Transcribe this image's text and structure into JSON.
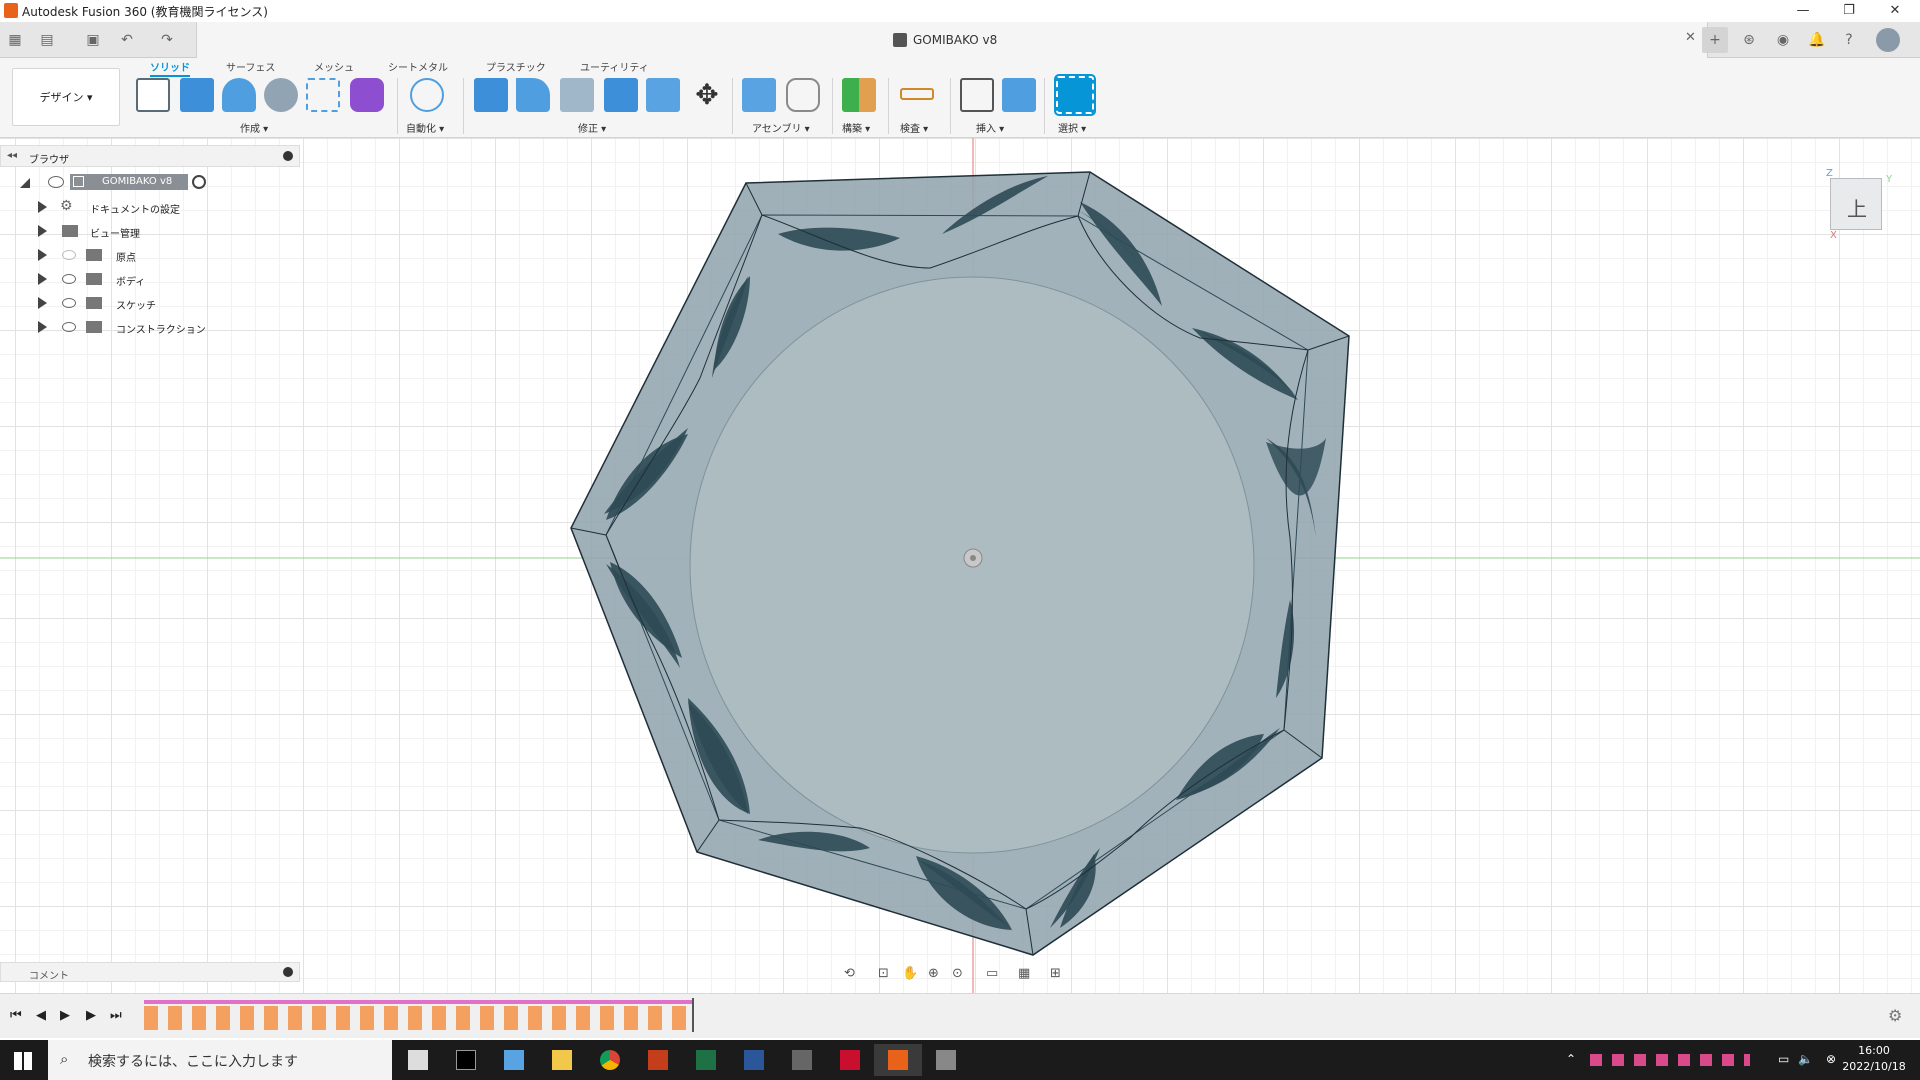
{
  "window": {
    "title": "Autodesk Fusion 360 (教育機関ライセンス)"
  },
  "document": {
    "name": "GOMIBAKO v8"
  },
  "ribbon": {
    "workspace": "デザイン",
    "tabs": [
      "ソリッド",
      "サーフェス",
      "メッシュ",
      "シートメタル",
      "プラスチック",
      "ユーティリティ"
    ],
    "active_tab": "ソリッド",
    "groups": [
      "作成",
      "自動化",
      "修正",
      "アセンブリ",
      "構築",
      "検査",
      "挿入",
      "選択"
    ]
  },
  "browser": {
    "title": "ブラウザ",
    "root": "GOMIBAKO v8",
    "items": [
      "ドキュメントの設定",
      "ビュー管理",
      "原点",
      "ボディ",
      "スケッチ",
      "コンストラクション"
    ]
  },
  "comment": {
    "label": "コメント"
  },
  "viewcube": {
    "face": "上",
    "axes": [
      "Z",
      "Y",
      "X"
    ]
  },
  "taskbar": {
    "search_placeholder": "検索するには、ここに入力します",
    "time": "16:00",
    "date": "2022/10/18"
  },
  "colors": {
    "accent": "#0696d7",
    "model_fill": "#8fa2ab",
    "model_dark": "#2e4a55",
    "axis_red": "#e57373",
    "axis_green": "#8fd38f"
  }
}
